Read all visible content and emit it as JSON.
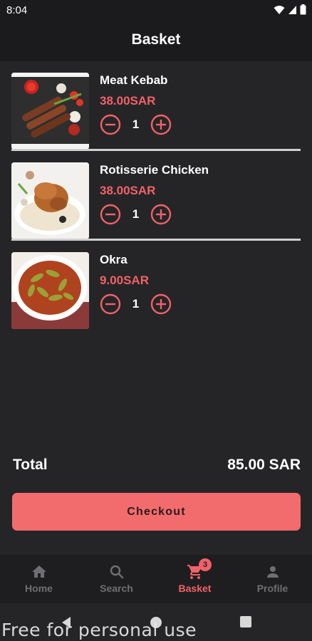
{
  "status_bar": {
    "time": "8:04"
  },
  "app_bar": {
    "title": "Basket"
  },
  "items": [
    {
      "name": "Meat Kebab",
      "price": "38.00SAR",
      "quantity": "1"
    },
    {
      "name": "Rotisserie Chicken",
      "price": "38.00SAR",
      "quantity": "1"
    },
    {
      "name": "Okra",
      "price": "9.00SAR",
      "quantity": "1"
    }
  ],
  "summary": {
    "total_label": "Total",
    "total_value": "85.00 SAR"
  },
  "checkout": {
    "label": "Checkout"
  },
  "bottom_nav": {
    "items": [
      {
        "label": "Home",
        "icon": "home-icon",
        "active": false
      },
      {
        "label": "Search",
        "icon": "search-icon",
        "active": false
      },
      {
        "label": "Basket",
        "icon": "cart-icon",
        "active": true,
        "badge": "3"
      },
      {
        "label": "Profile",
        "icon": "person-icon",
        "active": false
      }
    ]
  },
  "colors": {
    "accent": "#f16268",
    "button": "#f26c6e",
    "background": "#252528",
    "bar": "#1b1b1d"
  },
  "watermark": "Free for personal use"
}
